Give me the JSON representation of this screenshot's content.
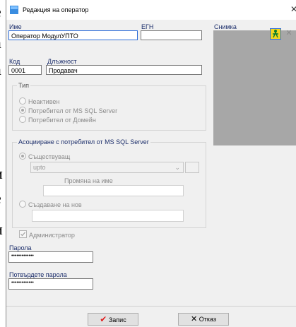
{
  "background_fragments": [
    "е",
    "а",
    "а",
    "и",
    "е",
    "и"
  ],
  "window": {
    "title": "Редакция на оператор",
    "close_glyph": "✕"
  },
  "form": {
    "name_label": "Име",
    "name_value": "Оператор МодулУПТО",
    "egn_label": "ЕГН",
    "egn_value": "",
    "photo_label": "Снимка",
    "code_label": "Код",
    "code_value": "0001",
    "position_label": "Длъжност",
    "position_value": "Продавач"
  },
  "type_group": {
    "title": "Тип",
    "options": [
      "Неактивен",
      "Потребител от MS SQL Server",
      "Потребител от Домейн"
    ],
    "selected": 1
  },
  "sql_group": {
    "title": "Асоцииране с потребител от MS SQL Server",
    "existing_label": "Съществуващ",
    "existing_value": "upto",
    "rename_label": "Промяна на име",
    "rename_value": "",
    "create_label": "Създаване на нов",
    "create_value": ""
  },
  "admin": {
    "label": "Администратор",
    "checked": true
  },
  "password": {
    "label": "Парола",
    "value": "•••••••••••••",
    "confirm_label": "Потвърдете парола",
    "confirm_value": "•••••••••••••"
  },
  "buttons": {
    "save": "Запис",
    "cancel": "Отказ"
  },
  "icons": {
    "title_icon": "window-app-icon",
    "photo_load": "person-icon",
    "photo_clear": "close-icon",
    "save": "checkmark-icon",
    "cancel": "x-icon"
  },
  "colors": {
    "label_blue": "#1c2e6b",
    "focus_border": "#2b6bd8",
    "photo_bg": "#a7a7a7",
    "save_check": "#e02020"
  }
}
